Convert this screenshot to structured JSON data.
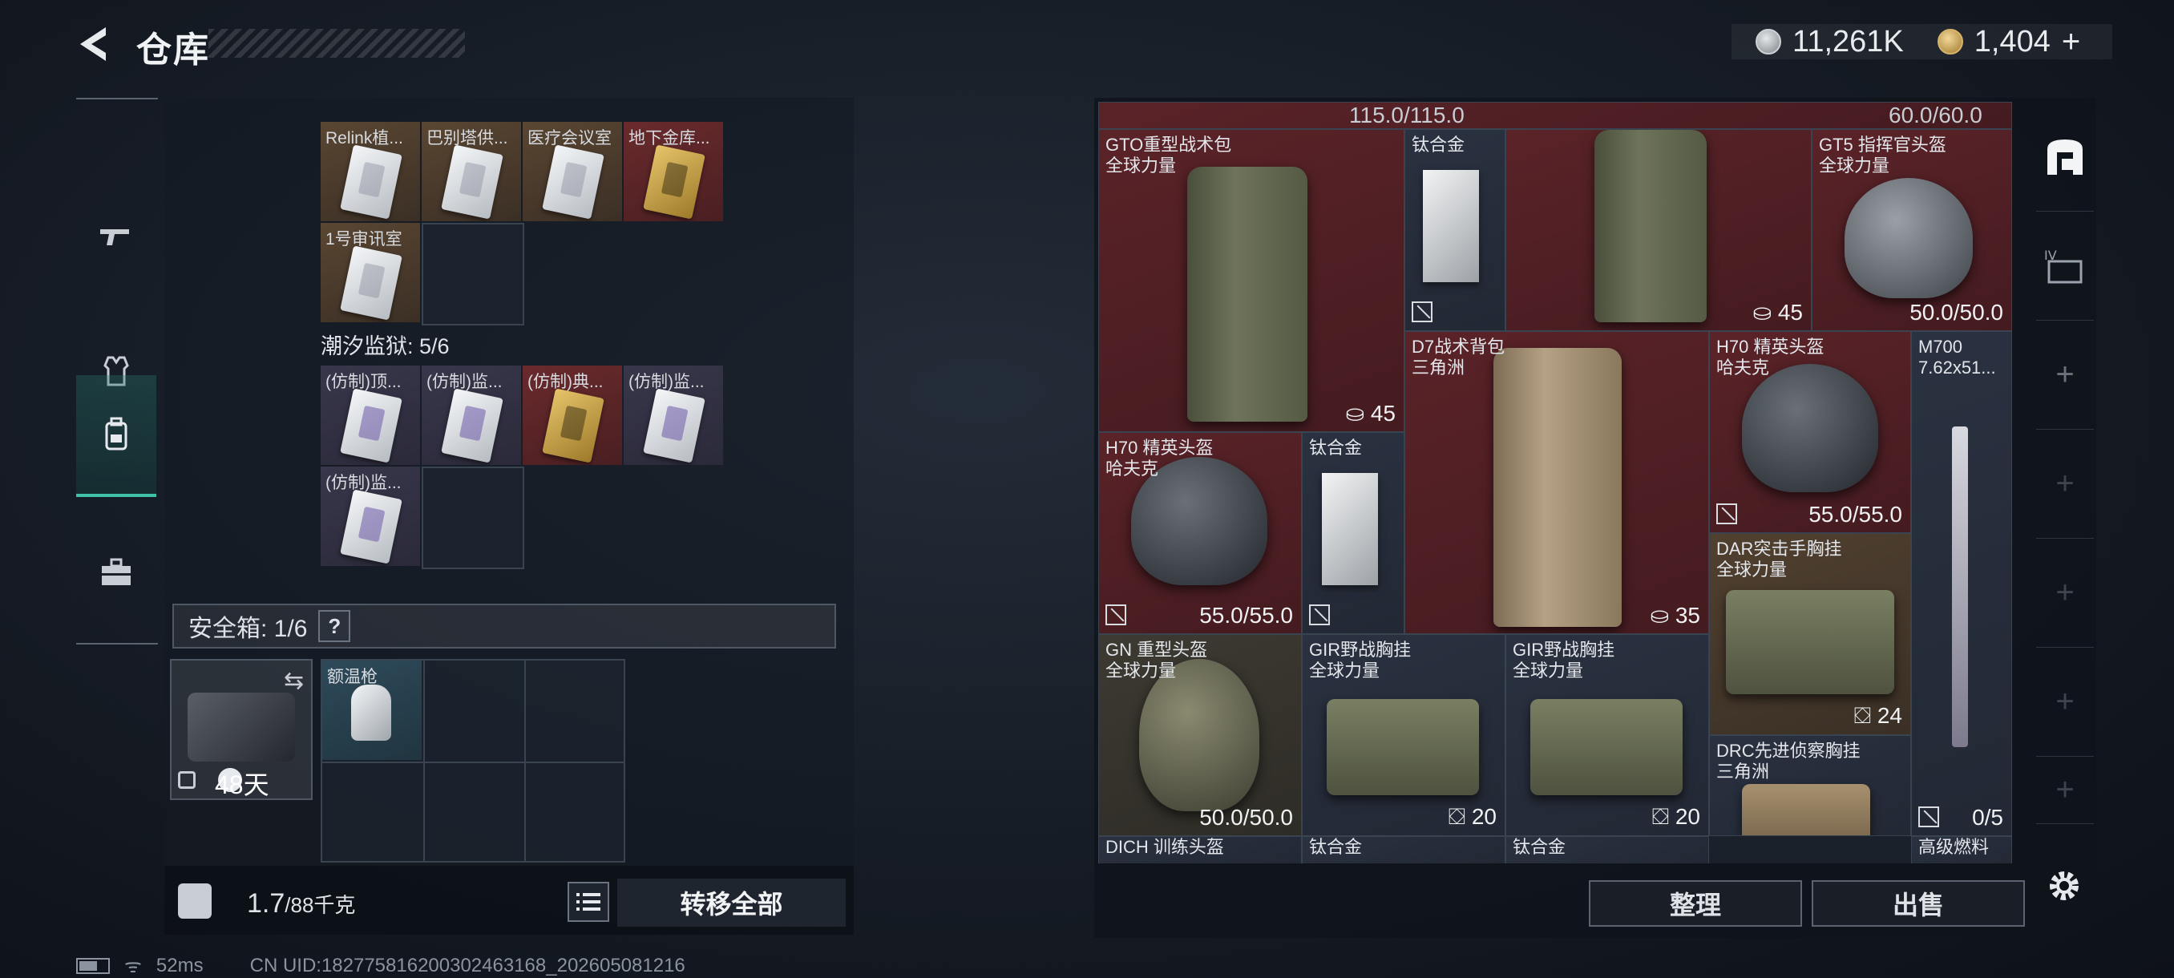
{
  "header": {
    "title": "仓库",
    "currency": [
      {
        "icon": "silver-coin-icon",
        "value": "11,261K"
      },
      {
        "icon": "gold-coin-icon",
        "value": "1,404"
      }
    ],
    "add_symbol": "+"
  },
  "left_nav": {
    "items": [
      {
        "name": "weapons",
        "icon": "gun-icon"
      },
      {
        "name": "armor",
        "icon": "vest-icon"
      },
      {
        "name": "backpack",
        "icon": "backpack-icon",
        "active": true
      },
      {
        "name": "toolbox",
        "icon": "toolbox-icon"
      }
    ]
  },
  "storage": {
    "row1_items": [
      {
        "label": "Relink植...",
        "style": "brown"
      },
      {
        "label": "巴别塔供...",
        "style": "brown"
      },
      {
        "label": "医疗会议室",
        "style": "brown"
      },
      {
        "label": "地下金库...",
        "style": "red"
      }
    ],
    "row2_items": [
      {
        "label": "1号审讯室",
        "style": "brown"
      }
    ],
    "tide_prison": {
      "label": "潮汐监狱: 5/6"
    },
    "prison_items": [
      {
        "label": "(仿制)顶...",
        "style": "purple"
      },
      {
        "label": "(仿制)监...",
        "style": "purple"
      },
      {
        "label": "(仿制)典...",
        "style": "red"
      },
      {
        "label": "(仿制)监...",
        "style": "purple"
      },
      {
        "label": "(仿制)监...",
        "style": "purple"
      }
    ]
  },
  "safe_box": {
    "label": "安全箱: 1/6",
    "help": "?",
    "days": "48天",
    "item_label": "额温枪"
  },
  "bottom_left": {
    "weight_current": "1.7",
    "weight_max": "/88千克",
    "transfer_all": "转移全部"
  },
  "right_grid": {
    "top_values": [
      "115.0/115.0",
      "60.0/60.0"
    ],
    "items": [
      {
        "label": "GTO重型战术包\n全球力量",
        "stat": "45"
      },
      {
        "label": "钛合金",
        "stat": ""
      },
      {
        "label": "",
        "stat": "45"
      },
      {
        "label": "GT5 指挥官头盔\n全球力量",
        "stat": "50.0/50.0"
      },
      {
        "label": "D7战术背包\n三角洲",
        "stat": "35"
      },
      {
        "label": "H70 精英头盔\n哈夫克",
        "stat": "55.0/55.0"
      },
      {
        "label": "M700\n7.62x51...",
        "stat": "0/5"
      },
      {
        "label": "H70 精英头盔\n哈夫克",
        "stat": "55.0/55.0"
      },
      {
        "label": "钛合金",
        "stat": ""
      },
      {
        "label": "DAR突击手胸挂\n全球力量",
        "stat": "24"
      },
      {
        "label": "GN 重型头盔\n全球力量",
        "stat": "50.0/50.0"
      },
      {
        "label": "GIR野战胸挂\n全球力量",
        "stat": "20"
      },
      {
        "label": "GIR野战胸挂\n全球力量",
        "stat": "20"
      },
      {
        "label": "DRC先进侦察胸挂\n三角洲",
        "stat": ""
      },
      {
        "label": "DICH 训练头盔",
        "stat": ""
      },
      {
        "label": "钛合金",
        "stat": ""
      },
      {
        "label": "钛合金",
        "stat": ""
      },
      {
        "label": "高级燃料",
        "stat": ""
      }
    ]
  },
  "bottom_right": {
    "sort": "整理",
    "sell": "出售"
  },
  "status_bar": {
    "ping": "52ms",
    "uid": "CN UID:1827758162003024631​68_202605081216"
  }
}
